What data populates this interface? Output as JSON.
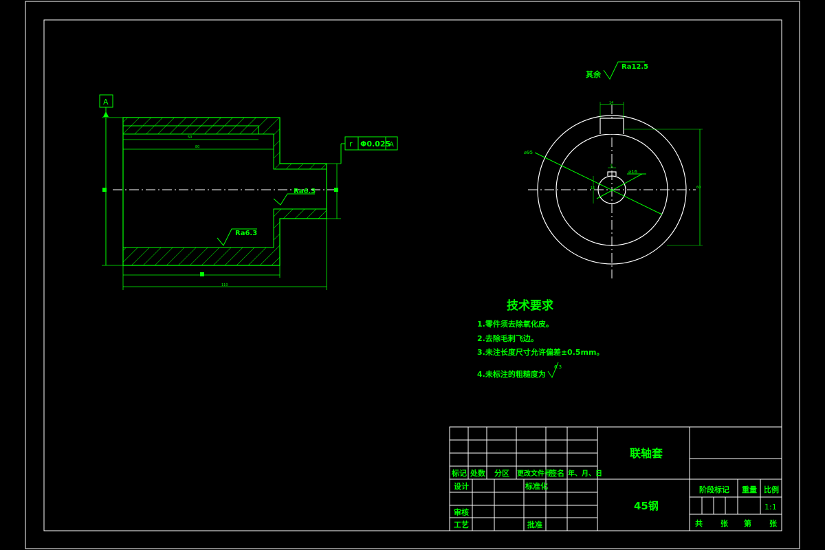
{
  "drawing": {
    "surface_rest": "其余",
    "surface_rest_value": "Ra12.5",
    "datum_label": "A",
    "tolerance_symbol": "r",
    "tolerance_value": "Φ0.025",
    "tolerance_datum": "A",
    "roughness_inner_small": "Ra6.3",
    "roughness_inner_large": "Ra6.3",
    "dim_inner_top": "50",
    "dim_bore_depth": "80",
    "dim_total_small": "80",
    "dim_overall": "110",
    "dim_left_dia": "60",
    "dim_right_dia": "16",
    "dim_key_width": "14",
    "dim_outer_dia": "60",
    "dim_small_key": "5",
    "dim_small_hole": "15",
    "circle_label_outer": "⌀95",
    "circle_label_inner": "⌀16"
  },
  "tech": {
    "title": "技术要求",
    "items": [
      "1.零件须去除氧化皮。",
      "2.去除毛刺飞边。",
      "3.未注长度尺寸允许偏差±0.5mm。",
      "4.未标注的粗糙度为"
    ],
    "roughness_value": "6.3"
  },
  "title_block": {
    "part_name": "联轴套",
    "material": "45钢",
    "headers": [
      "标记",
      "处数",
      "分区",
      "更改文件号",
      "签名",
      "年、月、日"
    ],
    "design": "设计",
    "standard": "标准化",
    "review": "审核",
    "process": "工艺",
    "approve": "批准",
    "stage_mark": "阶段标记",
    "weight": "重量",
    "scale_label": "比例",
    "scale_value": "1:1",
    "sheet_total": "共",
    "sheet_zhang1": "张",
    "sheet_di": "第",
    "sheet_zhang2": "张"
  }
}
